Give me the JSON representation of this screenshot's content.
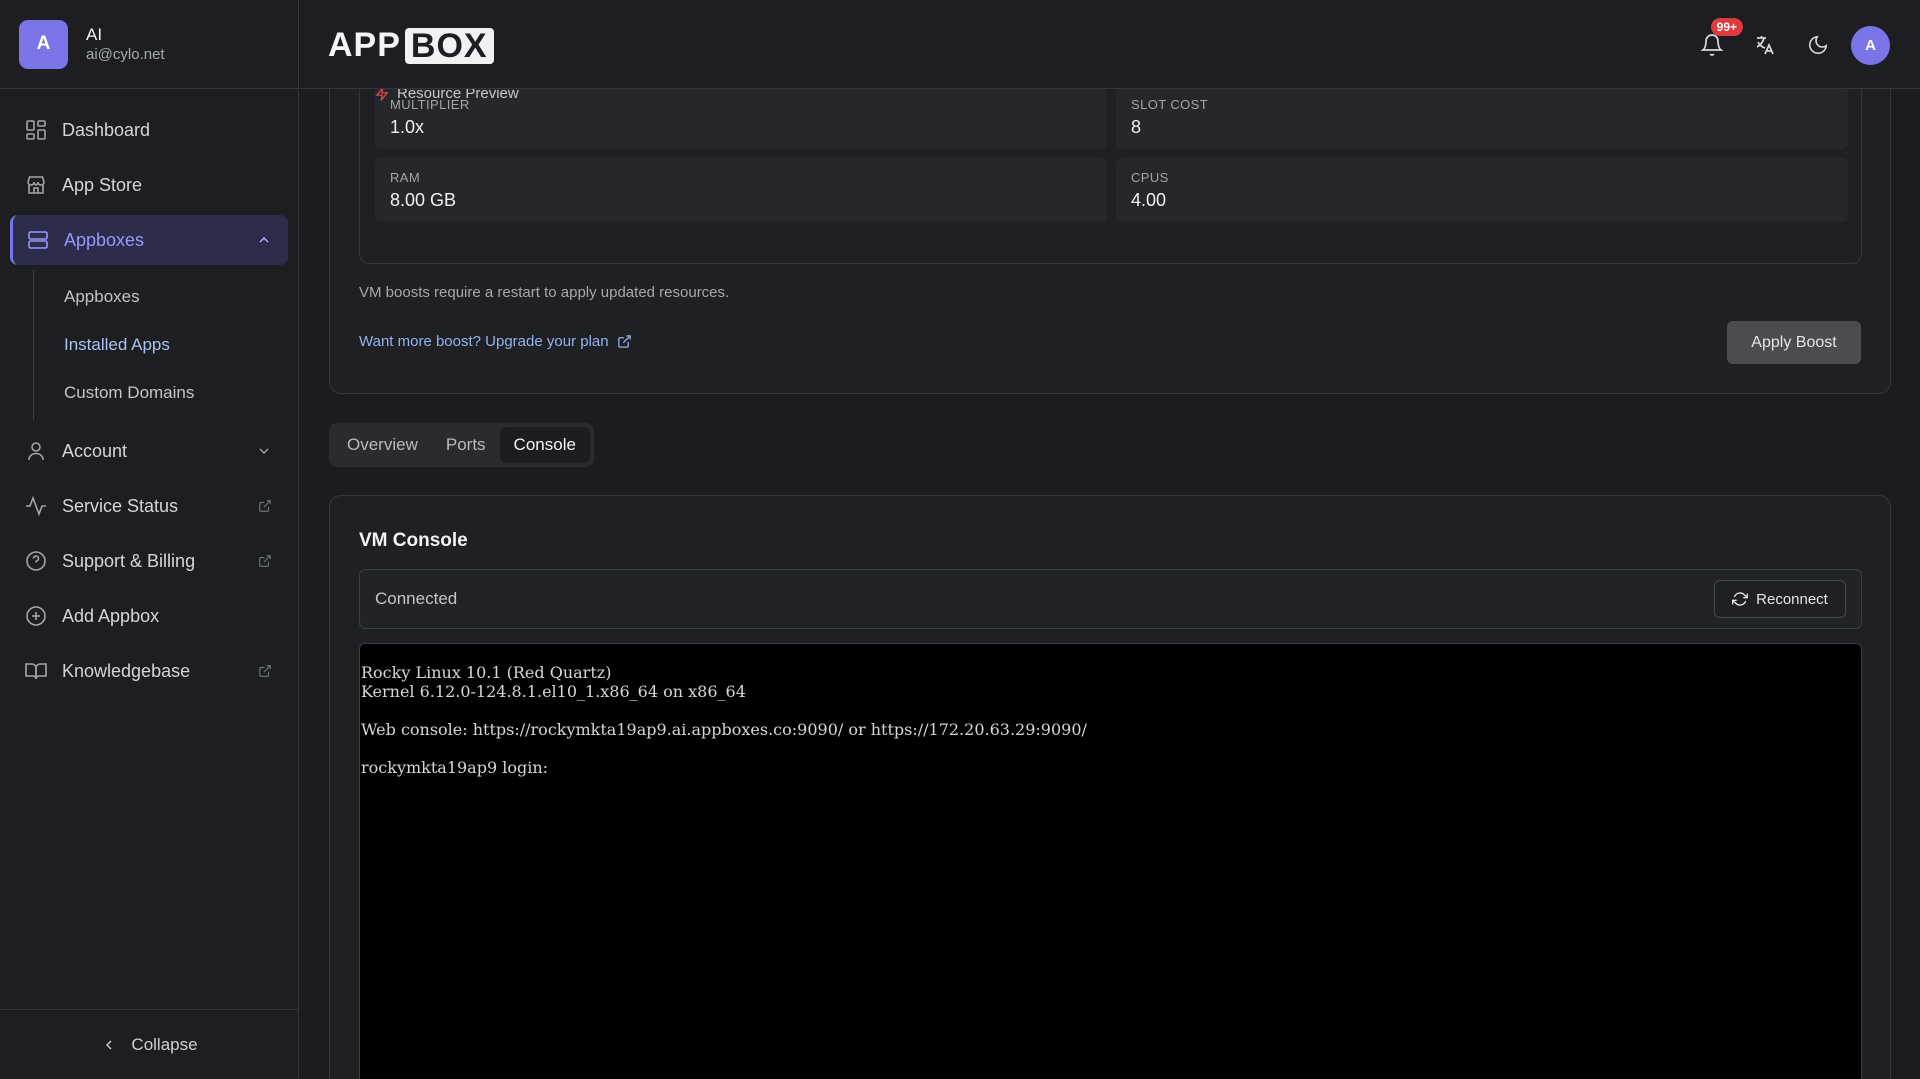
{
  "user": {
    "initial": "A",
    "name": "AI",
    "email": "ai@cylo.net"
  },
  "sidebar": {
    "items": [
      {
        "label": "Dashboard",
        "icon": "dashboard-icon"
      },
      {
        "label": "App Store",
        "icon": "store-icon"
      },
      {
        "label": "Appboxes",
        "icon": "server-icon",
        "active": true,
        "expanded": true
      },
      {
        "label": "Account",
        "icon": "user-icon"
      },
      {
        "label": "Service Status",
        "icon": "activity-icon",
        "external": true
      },
      {
        "label": "Support & Billing",
        "icon": "help-circle-icon",
        "external": true
      },
      {
        "label": "Add Appbox",
        "icon": "plus-circle-icon"
      },
      {
        "label": "Knowledgebase",
        "icon": "book-icon",
        "external": true
      }
    ],
    "subitems": [
      {
        "label": "Appboxes"
      },
      {
        "label": "Installed Apps",
        "active": true
      },
      {
        "label": "Custom Domains"
      }
    ],
    "collapse_label": "Collapse"
  },
  "header": {
    "logo_left": "APP",
    "logo_right": "BOX",
    "notification_badge": "99+",
    "avatar_initial": "A"
  },
  "boost": {
    "preview_title": "Resource Preview",
    "stats": [
      {
        "label": "MULTIPLIER",
        "value": "1.0x"
      },
      {
        "label": "SLOT COST",
        "value": "8"
      },
      {
        "label": "RAM",
        "value": "8.00 GB"
      },
      {
        "label": "CPUS",
        "value": "4.00"
      }
    ],
    "note": "VM boosts require a restart to apply updated resources.",
    "upgrade_link": "Want more boost? Upgrade your plan",
    "apply_label": "Apply Boost"
  },
  "tabs": [
    {
      "label": "Overview"
    },
    {
      "label": "Ports"
    },
    {
      "label": "Console",
      "active": true
    }
  ],
  "console": {
    "title": "VM Console",
    "status": "Connected",
    "reconnect_label": "Reconnect",
    "lines": [
      "Rocky Linux 10.1 (Red Quartz)",
      "Kernel 6.12.0-124.8.1.el10_1.x86_64 on x86_64",
      "",
      "Web console: https://rockymkta19ap9.ai.appboxes.co:9090/ or https://172.20.63.29:9090/",
      "",
      "rockymkta19ap9 login:"
    ]
  },
  "colors": {
    "accent": "#7b73e8",
    "link": "#92b4ec",
    "badge": "#e03a3e",
    "background": "#1b1c20",
    "terminal_bg": "#000000"
  }
}
